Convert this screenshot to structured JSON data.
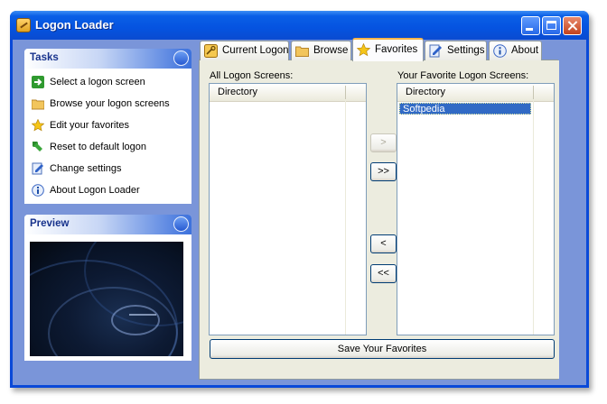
{
  "window": {
    "title": "Logon Loader"
  },
  "tasks_panel": {
    "title": "Tasks",
    "items": [
      {
        "label": "Select a logon screen",
        "icon": "green-arrow-icon"
      },
      {
        "label": "Browse your logon screens",
        "icon": "folder-icon"
      },
      {
        "label": "Edit your favorites",
        "icon": "star-icon"
      },
      {
        "label": "Reset to default logon",
        "icon": "reset-arrow-icon"
      },
      {
        "label": "Change settings",
        "icon": "settings-icon"
      },
      {
        "label": "About Logon Loader",
        "icon": "info-icon"
      }
    ]
  },
  "preview_panel": {
    "title": "Preview"
  },
  "tabs": [
    {
      "label": "Current Logon",
      "icon": "key-icon"
    },
    {
      "label": "Browse",
      "icon": "folder-icon"
    },
    {
      "label": "Favorites",
      "icon": "star-icon",
      "active": true
    },
    {
      "label": "Settings",
      "icon": "settings-icon"
    },
    {
      "label": "About",
      "icon": "info-icon"
    }
  ],
  "favorites": {
    "all_label": "All Logon Screens:",
    "fav_label": "Your Favorite Logon Screens:",
    "all_column": "Directory",
    "fav_column": "Directory",
    "all_items": [],
    "fav_items": [
      "Softpedia"
    ],
    "buttons": {
      "add": ">",
      "add_all": ">>",
      "remove": "<",
      "remove_all": "<<"
    },
    "save_label": "Save Your Favorites"
  },
  "colors": {
    "titlebar": "#0553e0",
    "client_bg": "#7a95d9",
    "selection": "#316ac5",
    "tab_highlight": "#f7b64a"
  }
}
